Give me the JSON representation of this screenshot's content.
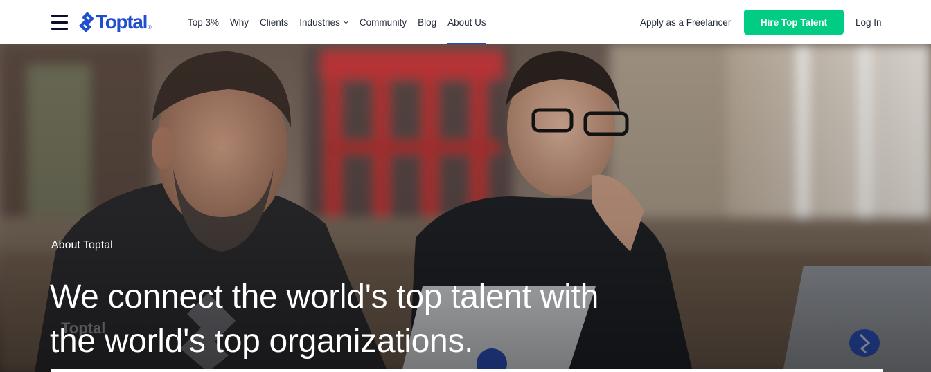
{
  "header": {
    "logo_text": "Toptal",
    "logo_registered": "®",
    "menu_icon": "hamburger-menu-icon",
    "nav": [
      {
        "label": "Top 3%"
      },
      {
        "label": "Why"
      },
      {
        "label": "Clients"
      },
      {
        "label": "Industries",
        "has_dropdown": true
      },
      {
        "label": "Community"
      },
      {
        "label": "Blog"
      },
      {
        "label": "About Us",
        "active": true
      }
    ],
    "apply_label": "Apply as a Freelancer",
    "hire_label": "Hire Top Talent",
    "login_label": "Log In"
  },
  "hero": {
    "eyebrow": "About Toptal",
    "headline": "We connect the world's top talent with the world's top organizations.",
    "photo_description_icon": "hero-photo"
  },
  "colors": {
    "brand_blue": "#204ecf",
    "cta_green": "#00cc83",
    "nav_text": "#262d3d",
    "hero_text": "#ffffff"
  }
}
